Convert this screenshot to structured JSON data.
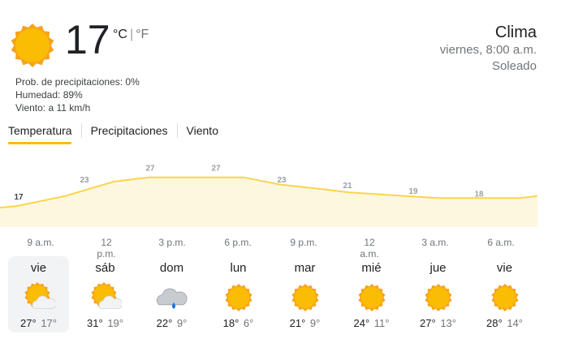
{
  "current": {
    "temperature": "17",
    "unit_c": "°C",
    "unit_sep": "|",
    "unit_f": "°F",
    "icon": "sun-icon",
    "precipitation": "Prob. de precipitaciones: 0%",
    "humidity": "Humedad: 89%",
    "wind": "Viento: a 11 km/h"
  },
  "header": {
    "title": "Clima",
    "datetime": "viernes, 8:00 a.m.",
    "condition": "Soleado"
  },
  "tabs": [
    {
      "label": "Temperatura",
      "active": true
    },
    {
      "label": "Precipitaciones",
      "active": false
    },
    {
      "label": "Viento",
      "active": false
    }
  ],
  "accent_color": "#fbbc04",
  "chart_data": {
    "type": "area",
    "series": [
      {
        "values": [
          17,
          23,
          27,
          27,
          23,
          21,
          19,
          18
        ]
      }
    ],
    "x": [
      "9 a.m.",
      "12 p.m.",
      "3 p.m.",
      "6 p.m.",
      "9 p.m.",
      "12 a.m.",
      "3 a.m.",
      "6 a.m."
    ],
    "data_labels": [
      "17",
      "23",
      "27",
      "27",
      "23",
      "21",
      "19",
      "18"
    ],
    "fill_color": "#fef7e0",
    "line_color": "#fbd44a"
  },
  "forecast": [
    {
      "day": "vie",
      "hi": "27°",
      "lo": "17°",
      "icon": "partly-cloudy-icon",
      "selected": true
    },
    {
      "day": "sáb",
      "hi": "31°",
      "lo": "19°",
      "icon": "partly-cloudy-icon"
    },
    {
      "day": "dom",
      "hi": "22°",
      "lo": "9°",
      "icon": "rain-cloud-icon"
    },
    {
      "day": "lun",
      "hi": "18°",
      "lo": "6°",
      "icon": "sun-icon"
    },
    {
      "day": "mar",
      "hi": "21°",
      "lo": "9°",
      "icon": "sun-icon"
    },
    {
      "day": "mié",
      "hi": "24°",
      "lo": "11°",
      "icon": "sun-icon"
    },
    {
      "day": "jue",
      "hi": "27°",
      "lo": "13°",
      "icon": "sun-icon"
    },
    {
      "day": "vie",
      "hi": "28°",
      "lo": "14°",
      "icon": "sun-icon"
    }
  ]
}
